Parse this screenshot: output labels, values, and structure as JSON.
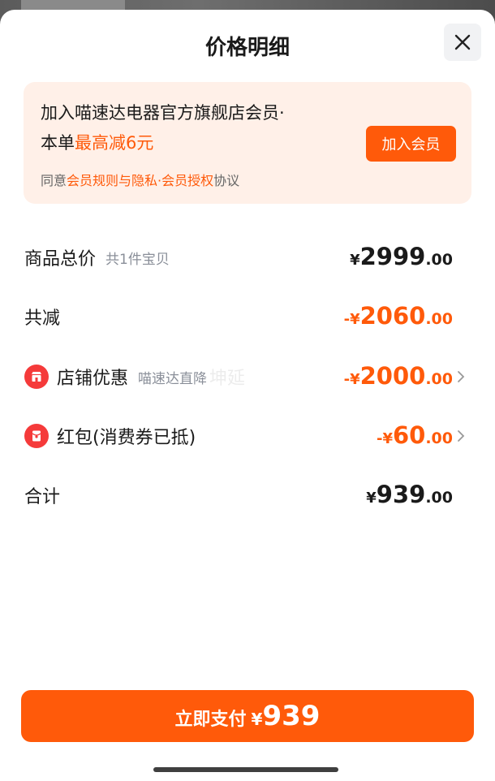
{
  "header": {
    "title": "价格明细"
  },
  "promo": {
    "line1": "加入喵速达电器官方旗舰店会员·",
    "line2_prefix": "本单",
    "line2_highlight": "最高减6元",
    "join_button": "加入会员",
    "agree_prefix": "同意",
    "agree_link": "会员规则与隐私·会员授权",
    "agree_suffix": "协议"
  },
  "rows": {
    "total": {
      "label": "商品总价",
      "sub": "共1件宝贝",
      "yen": "¥",
      "int": "2999",
      "dec": ".00"
    },
    "discount": {
      "label": "共减",
      "prefix": "-¥",
      "int": "2060",
      "dec": ".00"
    },
    "shop": {
      "label": "店铺优惠",
      "sub": "喵速达直降",
      "prefix": "-¥",
      "int": "2000",
      "dec": ".00"
    },
    "redpacket": {
      "label": "红包(消费券已抵)",
      "prefix": "-¥",
      "int": "60",
      "dec": ".00"
    },
    "sum": {
      "label": "合计",
      "yen": "¥",
      "int": "939",
      "dec": ".00"
    }
  },
  "watermark": "坤延",
  "pay": {
    "label": "立即支付",
    "yen": "¥",
    "amount": "939"
  },
  "colors": {
    "accent": "#ff5a0a",
    "promo_bg": "#fff0e8",
    "icon_red": "#f53a3a"
  }
}
